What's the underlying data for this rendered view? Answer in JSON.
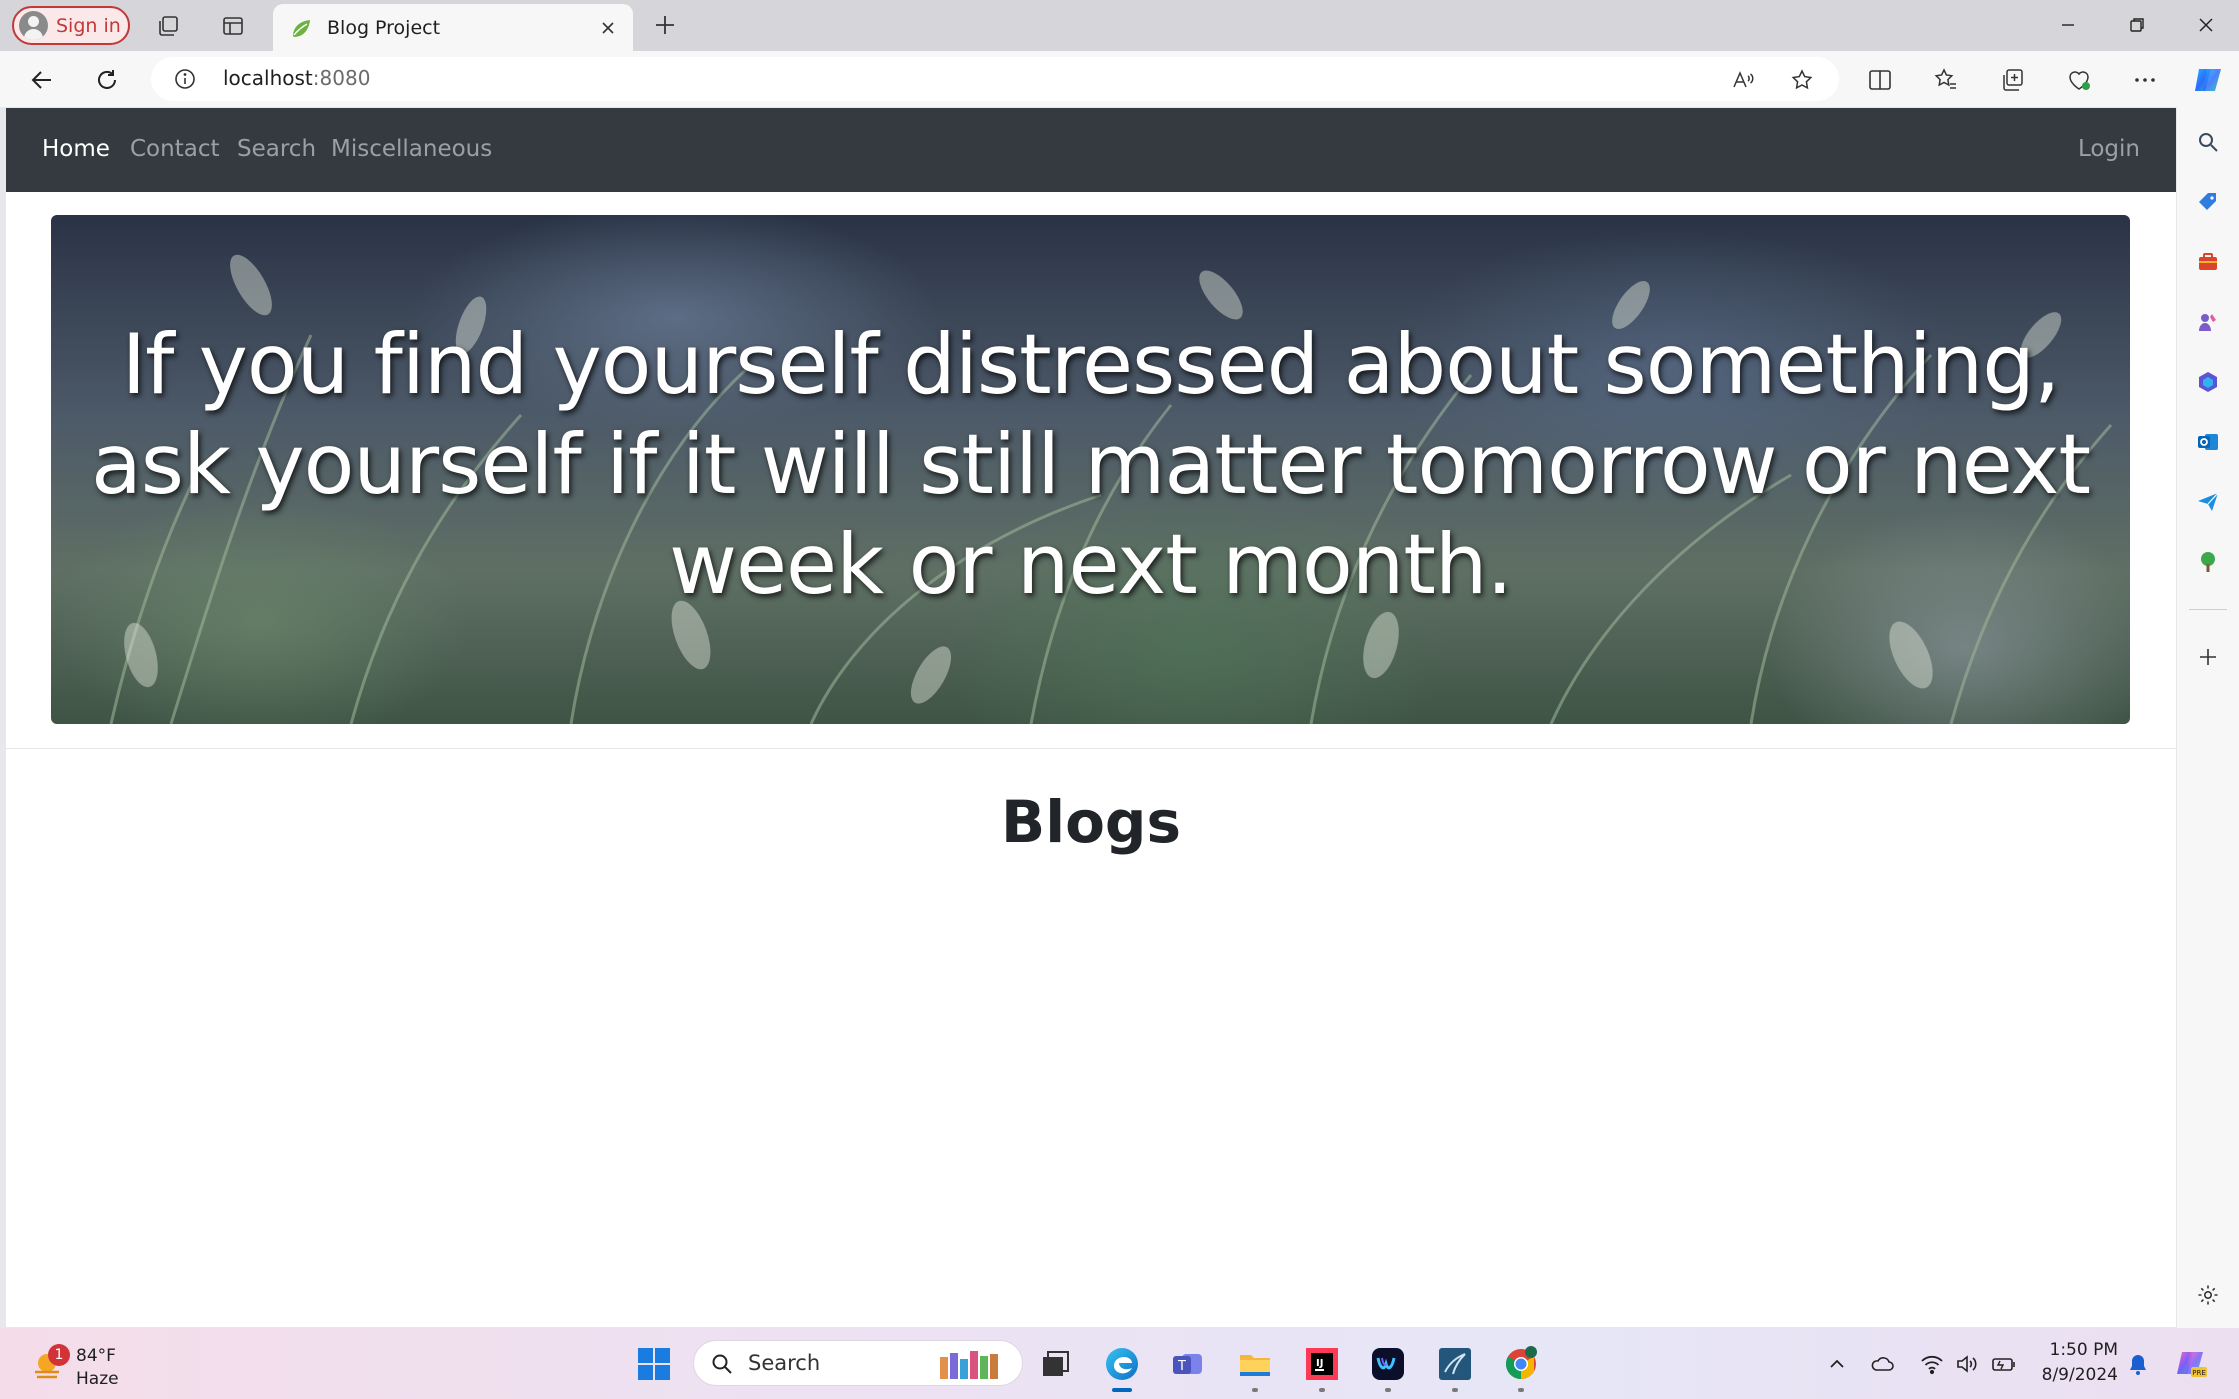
{
  "browser": {
    "signin_label": "Sign in",
    "tab_title": "Blog Project",
    "url_host": "localhost",
    "url_port": ":8080"
  },
  "site": {
    "nav": {
      "home": "Home",
      "contact": "Contact",
      "search": "Search",
      "misc": "Miscellaneous",
      "login": "Login"
    },
    "hero_quote": "If you find yourself distressed about something, ask yourself if it will still matter tomorrow or next week or next month.",
    "section_title": "Blogs"
  },
  "taskbar": {
    "weather_badge": "1",
    "weather_temp": "84°F",
    "weather_cond": "Haze",
    "search_label": "Search",
    "clock_time": "1:50 PM",
    "clock_date": "8/9/2024"
  },
  "colors": {
    "navbar_bg": "#343a40",
    "nav_active": "#ffffff",
    "nav_inactive": "#9aa0a6",
    "signin_accent": "#c0393b"
  }
}
